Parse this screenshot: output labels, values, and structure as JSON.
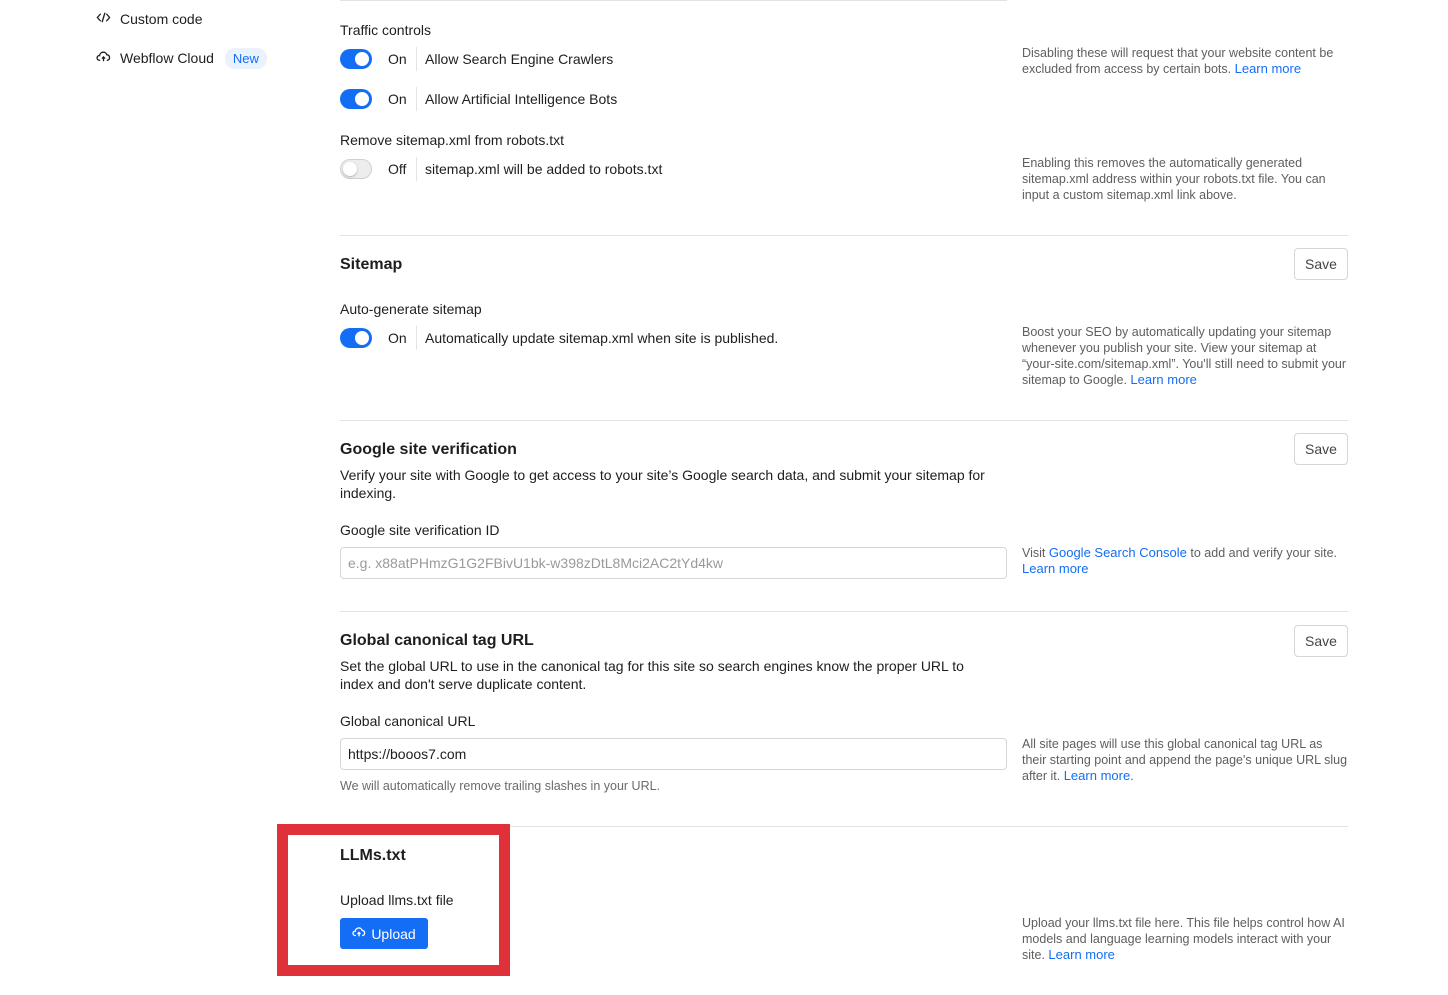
{
  "sidebar": {
    "items": [
      {
        "label": "Custom code",
        "icon": "code-icon"
      },
      {
        "label": "Webflow Cloud",
        "icon": "cloud-icon",
        "badge": "New"
      }
    ]
  },
  "traffic": {
    "title": "Traffic controls",
    "toggles": [
      {
        "state": "On",
        "label": "Allow Search Engine Crawlers"
      },
      {
        "state": "On",
        "label": "Allow Artificial Intelligence Bots"
      }
    ],
    "help": "Disabling these will request that your website content be excluded from access by certain bots.",
    "help_link": "Learn more"
  },
  "sitemap_robots": {
    "title": "Remove sitemap.xml from robots.txt",
    "state": "Off",
    "label": "sitemap.xml will be added to robots.txt",
    "help": "Enabling this removes the automatically generated sitemap.xml address within your robots.txt file. You can input a custom sitemap.xml link above."
  },
  "sitemap": {
    "title": "Sitemap",
    "save": "Save",
    "field_label": "Auto-generate sitemap",
    "state": "On",
    "label": "Automatically update sitemap.xml when site is published.",
    "help": "Boost your SEO by automatically updating your sitemap whenever you publish your site. View your sitemap at “your-site.com/sitemap.xml”. You'll still need to submit your sitemap to Google.",
    "help_link": "Learn more"
  },
  "google": {
    "title": "Google site verification",
    "save": "Save",
    "description": "Verify your site with Google to get access to your site’s Google search data, and submit your sitemap for indexing.",
    "field_label": "Google site verification ID",
    "placeholder": "e.g. x88atPHmzG1G2FBivU1bk-w398zDtL8Mci2AC2tYd4kw",
    "help_prefix": "Visit",
    "help_link1": "Google Search Console",
    "help_middle": "to add and verify your site.",
    "help_link2": "Learn more"
  },
  "canonical": {
    "title": "Global canonical tag URL",
    "save": "Save",
    "description": "Set the global URL to use in the canonical tag for this site so search engines know the proper URL to index and don't serve duplicate content.",
    "field_label": "Global canonical URL",
    "value": "https://booos7.com",
    "hint": "We will automatically remove trailing slashes in your URL.",
    "help": "All site pages will use this global canonical tag URL as their starting point and append the page's unique URL slug after it.",
    "help_link": "Learn more."
  },
  "llms": {
    "title": "LLMs.txt",
    "field_label": "Upload llms.txt file",
    "button": "Upload",
    "help": "Upload your llms.txt file here. This file helps control how AI models and language learning models interact with your site.",
    "help_link": "Learn more"
  },
  "colors": {
    "accent": "#146ef5",
    "highlight": "#e0313a"
  }
}
